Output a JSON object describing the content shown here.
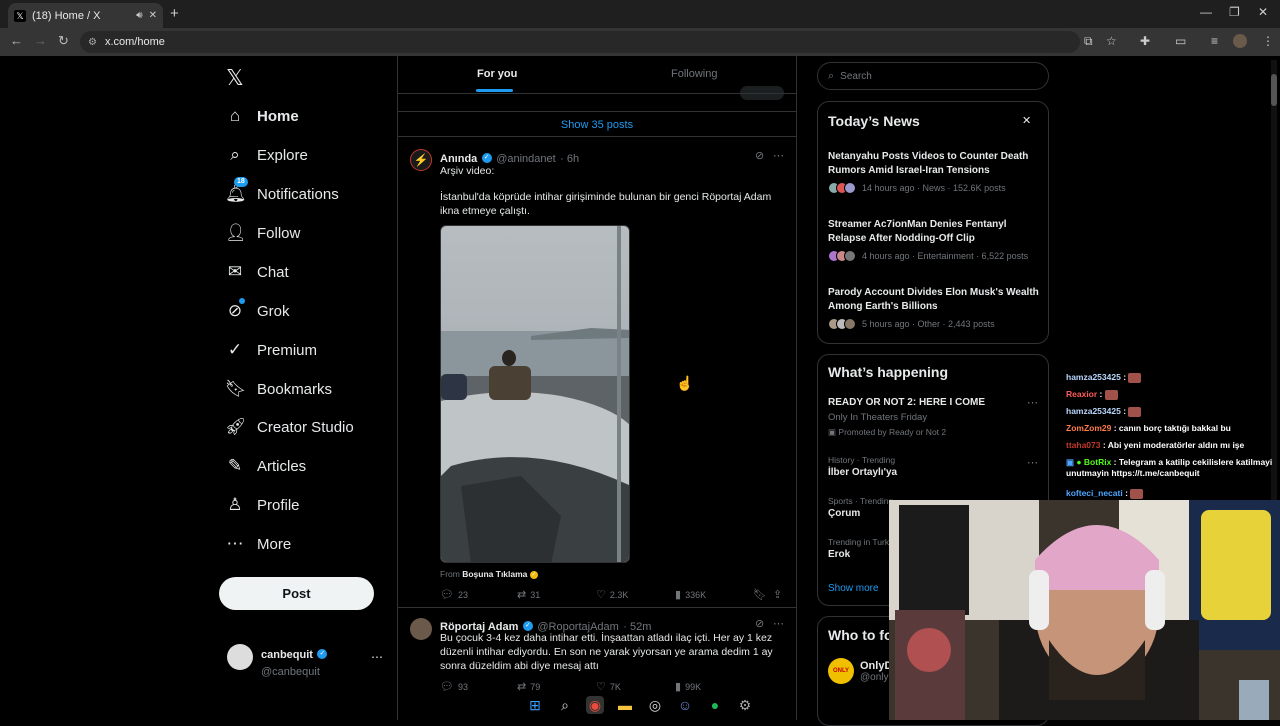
{
  "browser": {
    "tab_title": "(18) Home / X",
    "url": "x.com/home",
    "new_tab": "+",
    "tab_close": "✕"
  },
  "nav": {
    "logo": "𝕏",
    "items": [
      {
        "label": "Home",
        "icon": "home-icon"
      },
      {
        "label": "Explore",
        "icon": "search-icon"
      },
      {
        "label": "Notifications",
        "icon": "bell-icon"
      },
      {
        "label": "Follow",
        "icon": "follow-icon"
      },
      {
        "label": "Chat",
        "icon": "mail-icon"
      },
      {
        "label": "Grok",
        "icon": "grok-icon"
      },
      {
        "label": "Premium",
        "icon": "premium-icon"
      },
      {
        "label": "Bookmarks",
        "icon": "bookmark-icon"
      },
      {
        "label": "Creator Studio",
        "icon": "rocket-icon"
      },
      {
        "label": "Articles",
        "icon": "article-icon"
      },
      {
        "label": "Profile",
        "icon": "person-icon"
      },
      {
        "label": "More",
        "icon": "more-icon"
      }
    ],
    "notif_count": "18",
    "post_label": "Post",
    "account": {
      "name": "canbequit",
      "handle": "@canbequit"
    }
  },
  "feed": {
    "tab_for_you": "For you",
    "tab_following": "Following",
    "show_posts": "Show 35 posts",
    "post1": {
      "name": "Anında",
      "handle": "@anindanet",
      "time": "· 6h",
      "line1": "Arşiv video:",
      "line2": "İstanbul'da köprüde intihar girişiminde bulunan bir genci Röportaj Adam ikna etmeye çalıştı.",
      "from_label": "From",
      "from_name": "Boşuna Tıklama",
      "replies": "23",
      "reposts": "31",
      "likes": "2.3K",
      "views": "336K"
    },
    "post2": {
      "name": "Röportaj Adam",
      "handle": "@RoportajAdam",
      "time": "· 52m",
      "text": "Bu çocuk 3-4 kez daha intihar etti. İnşaattan atladı ilaç içti. Her ay 1 kez düzenli intihar ediyordu. En son ne yarak yiyorsan ye arama dedim 1 ay sonra düzeldim abi diye mesaj attı",
      "replies": "93",
      "reposts": "79",
      "likes": "7K",
      "views": "99K"
    }
  },
  "right": {
    "search_placeholder": "Search",
    "news_header": "Today’s News",
    "news": [
      {
        "title": "Netanyahu Posts Videos to Counter Death Rumors Amid Israel-Iran Tensions",
        "meta": "14 hours ago · News · 152.6K posts"
      },
      {
        "title": "Streamer Ac7ionMan Denies Fentanyl Relapse After Nodding-Off Clip",
        "meta": "4 hours ago · Entertainment · 6,522 posts"
      },
      {
        "title": "Parody Account Divides Elon Musk's Wealth Among Earth's Billions",
        "meta": "5 hours ago · Other · 2,443 posts"
      }
    ],
    "happening_header": "What’s happening",
    "trends": [
      {
        "category": "",
        "title": "READY OR NOT 2: HERE I COME",
        "sub": "Only In Theaters Friday",
        "promo": "Promoted by Ready or Not 2"
      },
      {
        "category": "History · Trending",
        "title": "İlber Ortaylı'ya"
      },
      {
        "category": "Sports · Trending",
        "title": "Çorum"
      },
      {
        "category": "Trending in Turkey",
        "title": "Erok"
      }
    ],
    "show_more": "Show more",
    "who_to_follow": "Who to follow",
    "suggest_name": "OnlyD",
    "suggest_handle": "@only"
  },
  "chat": [
    {
      "user": "hamza253425",
      "color": "#b9d7ff",
      "text": ""
    },
    {
      "user": "Reaxior",
      "color": "#ff5a5a",
      "text": ""
    },
    {
      "user": "hamza253425",
      "color": "#b9d7ff",
      "text": ""
    },
    {
      "user": "ZomZom29",
      "color": "#ff7a4d",
      "text": "canın borç taktığı bakkal bu"
    },
    {
      "user": "ttaha073",
      "color": "#c0392b",
      "text": "Abi yeni moderatörler aldın mı işe"
    },
    {
      "user": "BotRix",
      "color": "#53fc18",
      "text": "Telegram a katilip cekilislere katilmayi unutmayin https://t.me/canbequit"
    },
    {
      "user": "kofteci_necati",
      "color": "#4da6ff",
      "text": ""
    }
  ],
  "colors": {
    "accent": "#1d9bf0",
    "background": "#000000",
    "border": "#2f3336",
    "muted": "#71767b"
  }
}
